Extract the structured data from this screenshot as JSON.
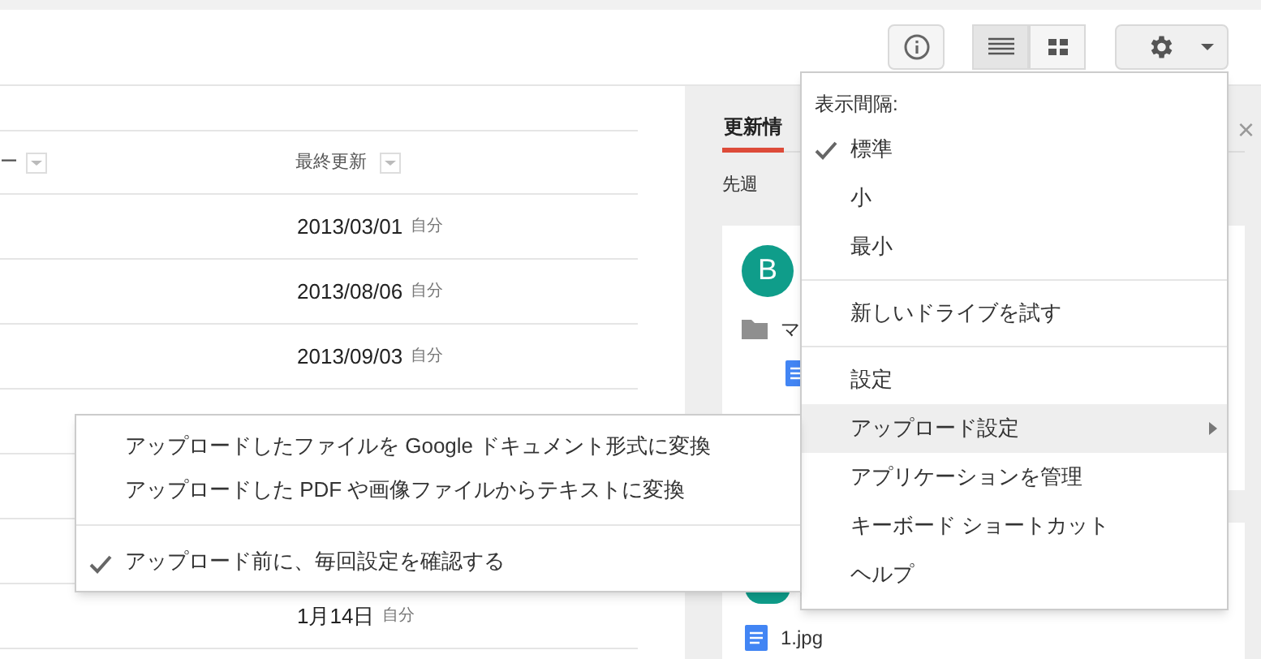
{
  "toolbar": {
    "view_buttons": [
      {
        "kind": "list",
        "selected": true
      },
      {
        "kind": "grid",
        "selected": false
      }
    ]
  },
  "table": {
    "columns": [
      "ー",
      "最終更新"
    ],
    "rows": [
      {
        "modified": "2013/03/01",
        "owner": "自分"
      },
      {
        "modified": "2013/08/06",
        "owner": "自分"
      },
      {
        "modified": "2013/09/03",
        "owner": "自分"
      },
      {
        "modified": "1月14日",
        "owner": "自分"
      }
    ]
  },
  "activity_panel": {
    "tab": "更新情",
    "close": "×",
    "period": "先週",
    "avatar": "B",
    "folder": "マ",
    "file": "1.jpg"
  },
  "settings_menu": {
    "header": "表示間隔:",
    "items": [
      {
        "kind": "option",
        "label": "標準",
        "checked": true
      },
      {
        "kind": "option",
        "label": "小",
        "checked": false
      },
      {
        "kind": "option",
        "label": "最小",
        "checked": false
      },
      {
        "kind": "divider"
      },
      {
        "kind": "item",
        "label": "新しいドライブを試す"
      },
      {
        "kind": "divider"
      },
      {
        "kind": "item",
        "label": "設定"
      },
      {
        "kind": "submenu",
        "label": "アップロード設定",
        "selected": true
      },
      {
        "kind": "item",
        "label": "アプリケーションを管理"
      },
      {
        "kind": "item",
        "label": "キーボード ショートカット"
      },
      {
        "kind": "item",
        "label": "ヘルプ"
      }
    ]
  },
  "upload_submenu": {
    "items": [
      {
        "kind": "option",
        "label": "アップロードしたファイルを Google ドキュメント形式に変換",
        "checked": false
      },
      {
        "kind": "option",
        "label": "アップロードした PDF や画像ファイルからテキストに変換",
        "checked": false
      },
      {
        "kind": "divider"
      },
      {
        "kind": "option",
        "label": "アップロード前に、毎回設定を確認する",
        "checked": true
      }
    ]
  }
}
